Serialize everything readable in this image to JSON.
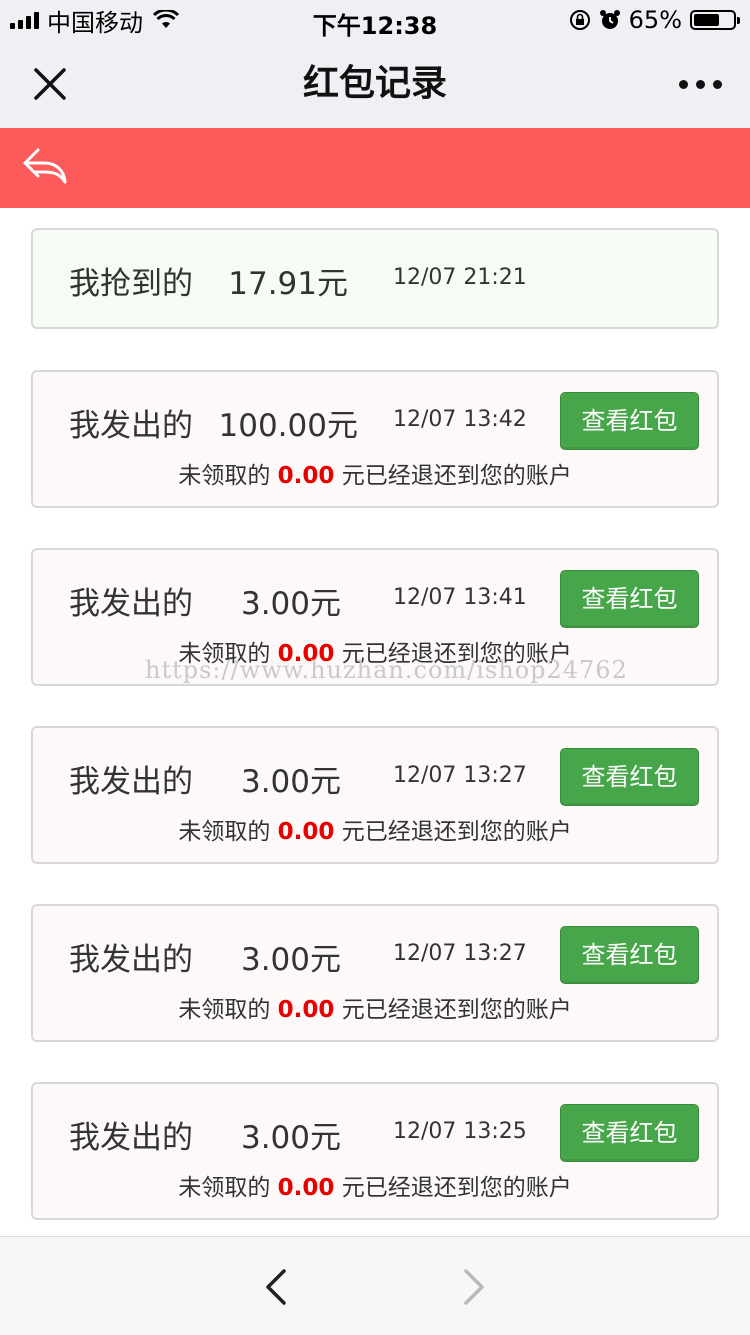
{
  "status_bar": {
    "carrier": "中国移动",
    "time": "下午12:38",
    "battery_text": "65%",
    "battery_level": 0.65
  },
  "nav": {
    "title": "红包记录"
  },
  "records": [
    {
      "type": "我抢到的",
      "amount": "17.91元",
      "time": "12/07 21:21"
    },
    {
      "type": "我发出的",
      "amount": "100.00元",
      "time": "12/07 13:42",
      "button": "查看红包",
      "note_prefix": "未领取的",
      "note_value": "0.00",
      "note_suffix": "元已经退还到您的账户"
    },
    {
      "type": "我发出的",
      "amount": "3.00元",
      "time": "12/07 13:41",
      "button": "查看红包",
      "note_prefix": "未领取的",
      "note_value": "0.00",
      "note_suffix": "元已经退还到您的账户"
    },
    {
      "type": "我发出的",
      "amount": "3.00元",
      "time": "12/07 13:27",
      "button": "查看红包",
      "note_prefix": "未领取的",
      "note_value": "0.00",
      "note_suffix": "元已经退还到您的账户"
    },
    {
      "type": "我发出的",
      "amount": "3.00元",
      "time": "12/07 13:27",
      "button": "查看红包",
      "note_prefix": "未领取的",
      "note_value": "0.00",
      "note_suffix": "元已经退还到您的账户"
    },
    {
      "type": "我发出的",
      "amount": "3.00元",
      "time": "12/07 13:25",
      "button": "查看红包",
      "note_prefix": "未领取的",
      "note_value": "0.00",
      "note_suffix": "元已经退还到您的账户"
    }
  ],
  "watermark": "https://www.huzhan.com/ishop24762",
  "colors": {
    "header_red": "#fd5a5a",
    "button_green": "#48a64a",
    "highlight_red": "#e80000"
  }
}
